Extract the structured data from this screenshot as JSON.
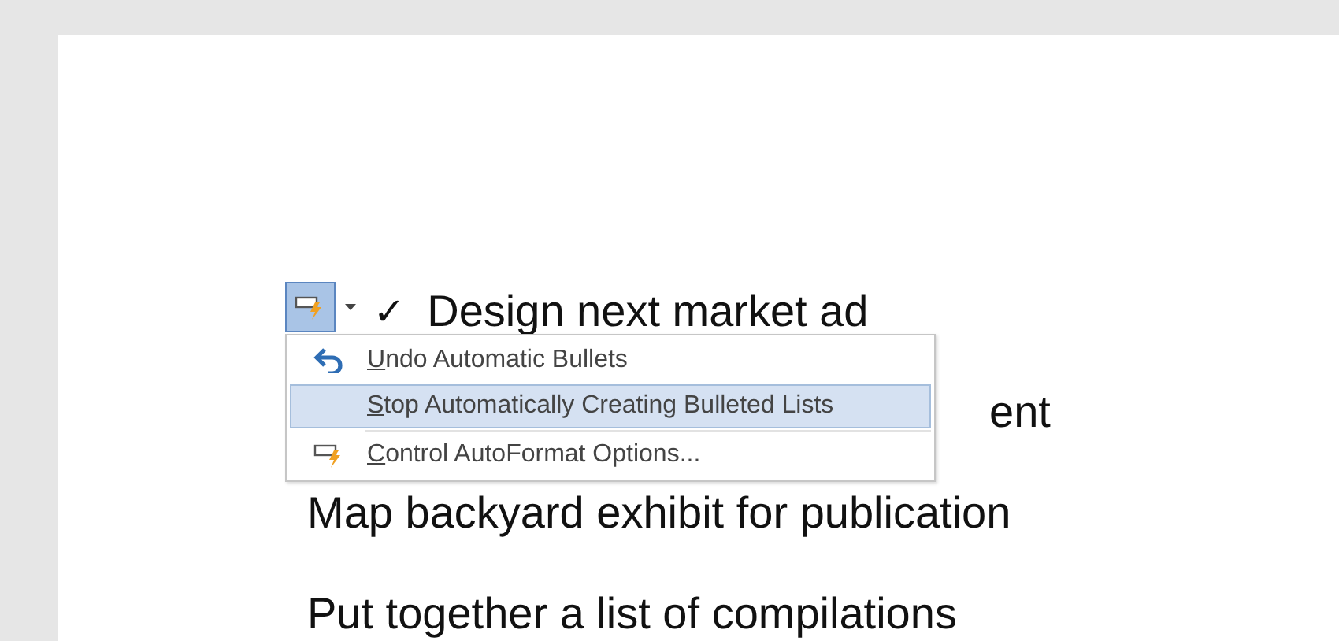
{
  "document": {
    "lines": [
      {
        "kind": "checked",
        "check": "✓",
        "text": "Design next market ad"
      },
      {
        "kind": "covered",
        "text": "ent"
      },
      {
        "kind": "plain",
        "text": "Map backyard exhibit for publication"
      },
      {
        "kind": "plain",
        "text": "Put together a list of compilations"
      }
    ]
  },
  "autoformat_button": {
    "expanded": true
  },
  "menu": {
    "items": [
      {
        "kind": "undo",
        "label": "Undo Automatic Bullets",
        "selected": false
      },
      {
        "kind": "none",
        "label": "Stop Automatically Creating Bulleted Lists",
        "selected": true
      },
      {
        "kind": "options",
        "label": "Control AutoFormat Options...",
        "selected": false
      }
    ]
  }
}
